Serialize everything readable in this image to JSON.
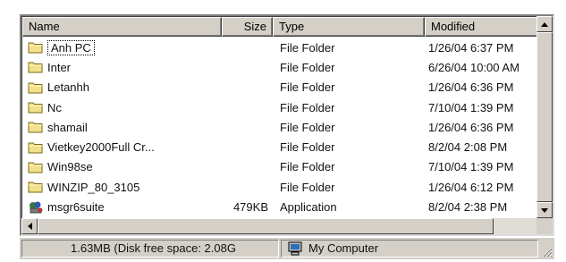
{
  "columns": {
    "name": "Name",
    "size": "Size",
    "type": "Type",
    "modified": "Modified"
  },
  "files": [
    {
      "name": "Anh PC",
      "size": "",
      "type": "File Folder",
      "modified": "1/26/04 6:37 PM",
      "icon": "folder-icon"
    },
    {
      "name": "Inter",
      "size": "",
      "type": "File Folder",
      "modified": "6/26/04 10:00 AM",
      "icon": "folder-icon"
    },
    {
      "name": "Letanhh",
      "size": "",
      "type": "File Folder",
      "modified": "1/26/04 6:36 PM",
      "icon": "folder-icon"
    },
    {
      "name": "Nc",
      "size": "",
      "type": "File Folder",
      "modified": "7/10/04 1:39 PM",
      "icon": "folder-icon"
    },
    {
      "name": "shamail",
      "size": "",
      "type": "File Folder",
      "modified": "1/26/04 6:36 PM",
      "icon": "folder-icon"
    },
    {
      "name": "Vietkey2000Full Cr...",
      "size": "",
      "type": "File Folder",
      "modified": "8/2/04 2:08 PM",
      "icon": "folder-icon"
    },
    {
      "name": "Win98se",
      "size": "",
      "type": "File Folder",
      "modified": "7/10/04 1:39 PM",
      "icon": "folder-icon"
    },
    {
      "name": "WINZIP_80_3105",
      "size": "",
      "type": "File Folder",
      "modified": "1/26/04 6:12 PM",
      "icon": "folder-icon"
    },
    {
      "name": "msgr6suite",
      "size": "479KB",
      "type": "Application",
      "modified": "8/2/04 2:38 PM",
      "icon": "application-icon"
    }
  ],
  "status": {
    "size_text": "1.63MB (Disk free space: 2.08G",
    "location": "My Computer"
  },
  "colors": {
    "chrome": "#d4d0c8",
    "folder": "#f2e08a"
  }
}
